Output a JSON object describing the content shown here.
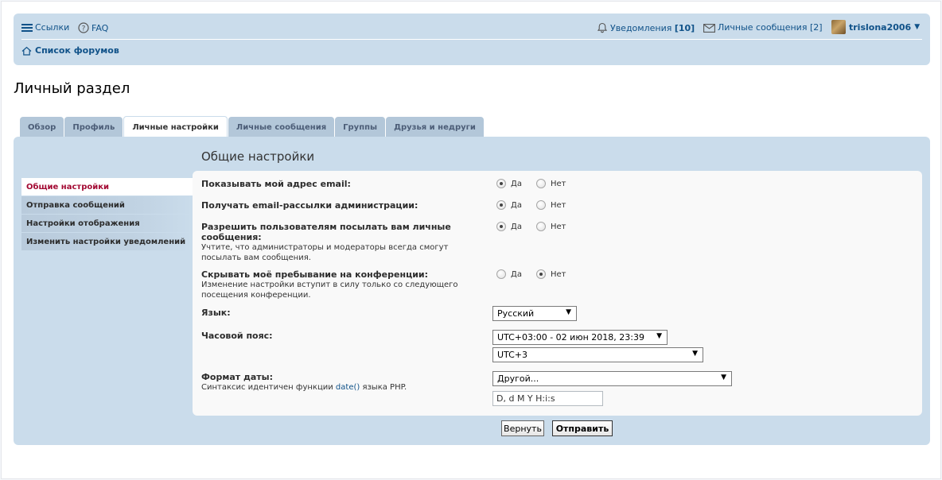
{
  "header": {
    "links_label": "Ссылки",
    "faq_label": "FAQ",
    "notifications_label": "Уведомления",
    "notifications_count": "[10]",
    "messages_label": "Личные сообщения",
    "messages_count": "[2]",
    "username": "trislona2006",
    "caret": "▼",
    "breadcrumb": "Список форумов"
  },
  "page_title": "Личный раздел",
  "tabs": [
    {
      "label": "Обзор"
    },
    {
      "label": "Профиль"
    },
    {
      "label": "Личные настройки",
      "active": true
    },
    {
      "label": "Личные сообщения"
    },
    {
      "label": "Группы"
    },
    {
      "label": "Друзья и недруги"
    }
  ],
  "sidebar": {
    "items": [
      {
        "label": "Общие настройки",
        "active": true
      },
      {
        "label": "Отправка сообщений"
      },
      {
        "label": "Настройки отображения"
      },
      {
        "label": "Изменить настройки уведомлений"
      }
    ]
  },
  "form": {
    "title": "Общие настройки",
    "yes_label": "Да",
    "no_label": "Нет",
    "show_email": {
      "label": "Показывать мой адрес email:",
      "selected": "yes"
    },
    "admin_email": {
      "label": "Получать email-рассылки администрации:",
      "selected": "yes"
    },
    "allow_pm": {
      "label": "Разрешить пользователям посылать вам личные сообщения:",
      "explain": "Учтите, что администраторы и модераторы всегда смогут посылать вам сообщения.",
      "selected": "yes"
    },
    "hide_online": {
      "label": "Скрывать моё пребывание на конференции:",
      "explain": "Изменение настройки вступит в силу только со следующего посещения конференции.",
      "selected": "no"
    },
    "language": {
      "label": "Язык:",
      "value": "Русский"
    },
    "timezone": {
      "label": "Часовой пояс:",
      "value": "UTC+03:00 - 02 июн 2018, 23:39",
      "zone_value": "UTC+3"
    },
    "date_format": {
      "label": "Формат даты:",
      "explain_before": "Синтаксис идентичен функции ",
      "explain_link": "date()",
      "explain_after": " языка PHP.",
      "select_value": "Другой...",
      "custom_value": "D, d M Y H:i:s"
    },
    "reset_label": "Вернуть",
    "submit_label": "Отправить"
  },
  "colors": {
    "panel_bg": "#cadceb",
    "link": "#105289",
    "active_menu": "#a30a33"
  }
}
